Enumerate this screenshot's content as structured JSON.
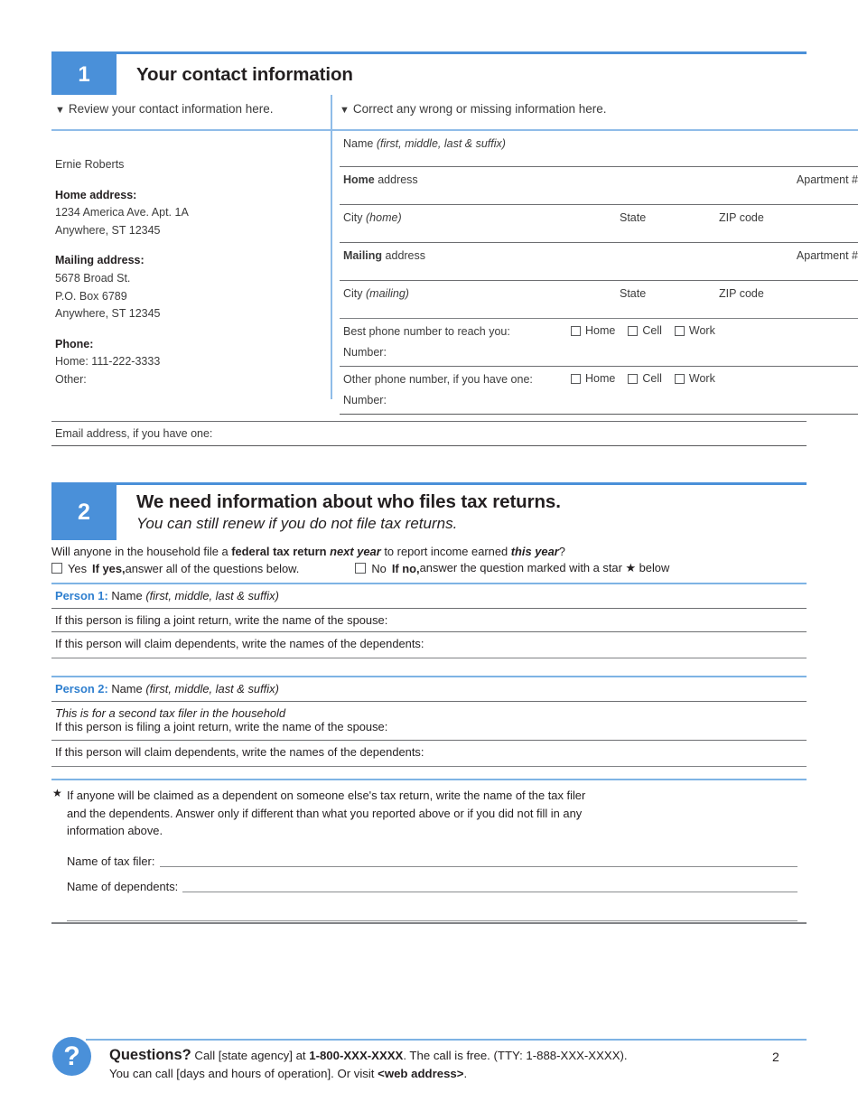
{
  "document": {
    "page_number": "2"
  },
  "section1": {
    "number": "1",
    "title": "Your contact information",
    "col_left_header": "Review your contact information here.",
    "col_right_header": "Correct any wrong or missing information here.",
    "printed": {
      "name": "Ernie Roberts",
      "home_address_label": "Home address:",
      "home_address_line1": "1234 America Ave. Apt. 1A",
      "home_address_line2": "Anywhere, ST 12345",
      "mailing_address_label": "Mailing address:",
      "mailing_address_line1": "5678 Broad St.",
      "mailing_address_line2": "P.O. Box 6789",
      "mailing_address_line3": "Anywhere, ST 12345",
      "phone_label": "Phone:",
      "phone_home": "Home: 111-222-3333",
      "phone_other": "Other:"
    },
    "fields": {
      "name_label": "Name",
      "name_hint": "(first, middle, last & suffix)",
      "home_bold": "Home",
      "home_rest": " address",
      "apartment": "Apartment #",
      "city_home_label": "City",
      "city_home_hint": "(home)",
      "state": "State",
      "zip": "ZIP code",
      "mailing_bold": "Mailing",
      "mailing_rest": " address",
      "city_mailing_label": "City",
      "city_mailing_hint": "(mailing)",
      "best_phone": "Best phone number to reach you:",
      "number": "Number:",
      "other_phone": "Other phone number, if you have one:",
      "phone_types": [
        "Home",
        "Cell",
        "Work"
      ],
      "email": "Email address, if you have one:"
    }
  },
  "section2": {
    "number": "2",
    "title": "We need information about who files tax returns.",
    "subtitle": "You can still renew if you do not file tax returns.",
    "question": {
      "part1": "Will anyone in the household file a ",
      "bold1": "federal tax return",
      "bolditalic1": " next year",
      "part2": " to report income earned ",
      "bolditalic2": "this year",
      "part3": "?"
    },
    "yes_option": {
      "label": "Yes",
      "bold": "If yes,",
      "rest": " answer all of the questions below."
    },
    "no_option": {
      "label": "No",
      "bold": "If no,",
      "rest": " answer the question marked with a star ★ below"
    },
    "person1": {
      "tag": "Person 1:",
      "name_label": " Name ",
      "name_hint": "(first, middle, last & suffix)",
      "spouse_line": "If this person is filing a joint return, write the name of the spouse:",
      "dependents_line": "If this person will claim dependents, write the names of the dependents:"
    },
    "person2": {
      "tag": "Person 2:",
      "name_label": " Name ",
      "name_hint": "(first, middle, last & suffix)",
      "note": "This is for a second tax filer in the household",
      "spouse_line": "If this person is filing a joint return, write the name of the spouse:",
      "dependents_line": "If this person will claim dependents, write the names of the dependents:"
    },
    "star_note": {
      "marker": "★",
      "line1": "If anyone will be claimed as a dependent on someone else's tax return, write the name of the tax filer",
      "line2": "and the dependents. Answer only if different than what you reported above or if you did not fill in any",
      "line3": "information above.",
      "tax_filer_label": "Name of tax filer:",
      "dependents_label": "Name of dependents:"
    }
  },
  "footer": {
    "icon": "question-mark-icon",
    "questions_label": "Questions?",
    "line1_a": " Call [state agency] at ",
    "line1_phone": "1-800-XXX-XXXX",
    "line1_b": ". The call is free. (TTY: 1-888-XXX-XXXX).",
    "line2_a": "You can call [days and hours of operation]. Or visit ",
    "line2_web": "<web address>",
    "line2_b": "."
  },
  "colors": {
    "accent_blue": "#4a90d9",
    "light_blue_rule": "#8fbce8",
    "gray_rule": "#6d6e71",
    "person_tag_blue": "#2f7fcf"
  }
}
